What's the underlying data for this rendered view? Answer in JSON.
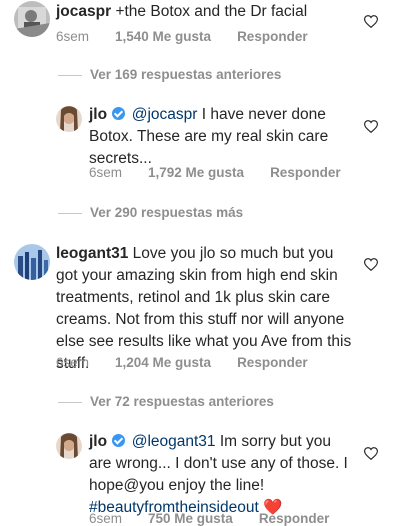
{
  "comments": [
    {
      "username": "jocaspr",
      "text": "+the Botox and the Dr facial",
      "time": "6sem",
      "likes": "1,540 Me gusta",
      "reply": "Responder"
    },
    {
      "username": "jlo",
      "mention": "@jocaspr",
      "text": "I have never done Botox. These are my real skin care secrets...",
      "time": "6sem",
      "likes": "1,792 Me gusta",
      "reply": "Responder"
    },
    {
      "username": "leogant31",
      "text": "Love you jlo so much but you got your amazing skin from high end skin treatments, retinol and 1k plus skin care creams. Not from this stuff nor will anyone else see results like what you Ave from this stuff.",
      "time": "6sem",
      "likes": "1,204 Me gusta",
      "reply": "Responder"
    },
    {
      "username": "jlo",
      "mention": "@leogant31",
      "text": "Im sorry but you are wrong... I don't use any of those. I hope@you enjoy the line!",
      "hashtag": "#beautyfromtheinsideout",
      "emoji": "❤️",
      "time": "6sem",
      "likes": "750 Me gusta",
      "reply": "Responder"
    }
  ],
  "view_more": [
    "Ver 169 respuestas anteriores",
    "Ver 290 respuestas más",
    "Ver 72 respuestas anteriores"
  ],
  "colors": {
    "text": "#262626",
    "muted": "#8e8e8e",
    "verified": "#3897f0",
    "link": "#00376b",
    "heart": "#ed4956"
  },
  "icons": [
    "heart-outline-icon",
    "verified-badge-icon"
  ]
}
